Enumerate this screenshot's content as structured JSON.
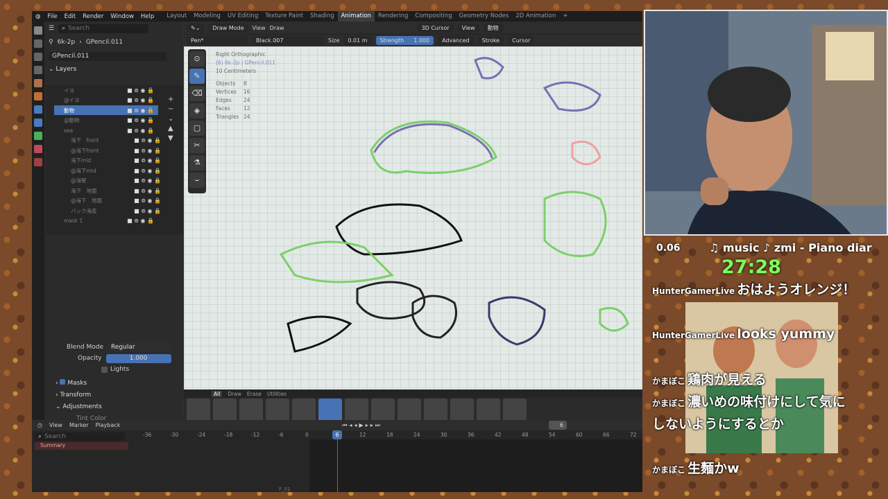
{
  "topbar": {
    "menus": [
      "File",
      "Edit",
      "Render",
      "Window",
      "Help"
    ],
    "workspaces": [
      "Layout",
      "Modeling",
      "UV Editing",
      "Texture Paint",
      "Shading",
      "Animation",
      "Rendering",
      "Compositing",
      "Geometry Nodes",
      "2D Animation"
    ],
    "active_workspace": "Animation",
    "add_tab": "+"
  },
  "properties": {
    "search_placeholder": "Search",
    "object_name": "6k-2p",
    "data_name": "GPencil.011",
    "datablock": "GPencil.011",
    "layers_title": "Layers",
    "layers": [
      {
        "name": "イヨ"
      },
      {
        "name": "@イヨ"
      },
      {
        "name": "動物"
      },
      {
        "name": "@動物"
      },
      {
        "name": "sea"
      },
      {
        "name": "海下　front"
      },
      {
        "name": "@海下front"
      },
      {
        "name": "海下mid"
      },
      {
        "name": "@海下mid"
      },
      {
        "name": "@海堅"
      },
      {
        "name": "海下　地面"
      },
      {
        "name": "@海下　地面"
      },
      {
        "name": "バック海底"
      },
      {
        "name": "mask 1"
      }
    ],
    "selected_layer_index": 2,
    "blend_mode_label": "Blend Mode",
    "blend_mode_value": "Regular",
    "opacity_label": "Opacity",
    "opacity_value": "1.000",
    "lights_label": "Lights",
    "masks_label": "Masks",
    "transform_label": "Transform",
    "adjustments_label": "Adjustments",
    "tint_color_label": "Tint Color"
  },
  "viewport": {
    "mode": "Draw Mode",
    "menu_view": "View",
    "menu_draw": "Draw",
    "cursor": "3D Cursor",
    "view_dd": "View",
    "collection": "動物",
    "brush": "Pen*",
    "material": "Black.007",
    "size_label": "Size",
    "size_value": "0.01 m",
    "strength_label": "Strength",
    "strength_value": "1.000",
    "advanced": "Advanced",
    "stroke": "Stroke",
    "cursor_dd": "Cursor",
    "info_view": "Right Orthographic",
    "info_object": "(6) 6k-2p | GPencil.011",
    "info_scale": "10 Centimeters",
    "stats": [
      {
        "label": "Objects",
        "value": "8"
      },
      {
        "label": "Vertices",
        "value": "16"
      },
      {
        "label": "Edges",
        "value": "24"
      },
      {
        "label": "Faces",
        "value": "12"
      },
      {
        "label": "Triangles",
        "value": "24"
      }
    ],
    "shelf_tabs": [
      "All",
      "Draw",
      "Erase",
      "Utilities"
    ],
    "shelf_active": "All"
  },
  "timeline": {
    "view": "View",
    "marker": "Marker",
    "playback": "Playback",
    "search_placeholder": "Search",
    "summary": "Summary",
    "ticks": [
      "-36",
      "-30",
      "-24",
      "-18",
      "-12",
      "-6",
      "0",
      "6",
      "12",
      "18",
      "24",
      "30",
      "36",
      "42",
      "48",
      "54",
      "60",
      "66",
      "72"
    ],
    "current_frame": "6",
    "frame_field": "6",
    "footer_frame": "F_01"
  },
  "overlay": {
    "timer_small": "0.06",
    "music": "♫ music ♪ zmi - Piano diar",
    "timer": "27:28",
    "chat": [
      {
        "name": "HunterGamerLive",
        "text": "おはようオレンジ！"
      },
      {
        "name": "HunterGamerLive",
        "text": "looks yummy"
      },
      {
        "name": "かまぼこ",
        "text": "鶏肉が見える"
      },
      {
        "name": "かまぼこ",
        "text": "濃いめの味付けにして気にしないようにするとか"
      },
      {
        "name": "かまぼこ",
        "text": "生麵かw"
      }
    ]
  },
  "colors": {
    "accent": "#4772b3",
    "timer": "#7cff5a"
  }
}
